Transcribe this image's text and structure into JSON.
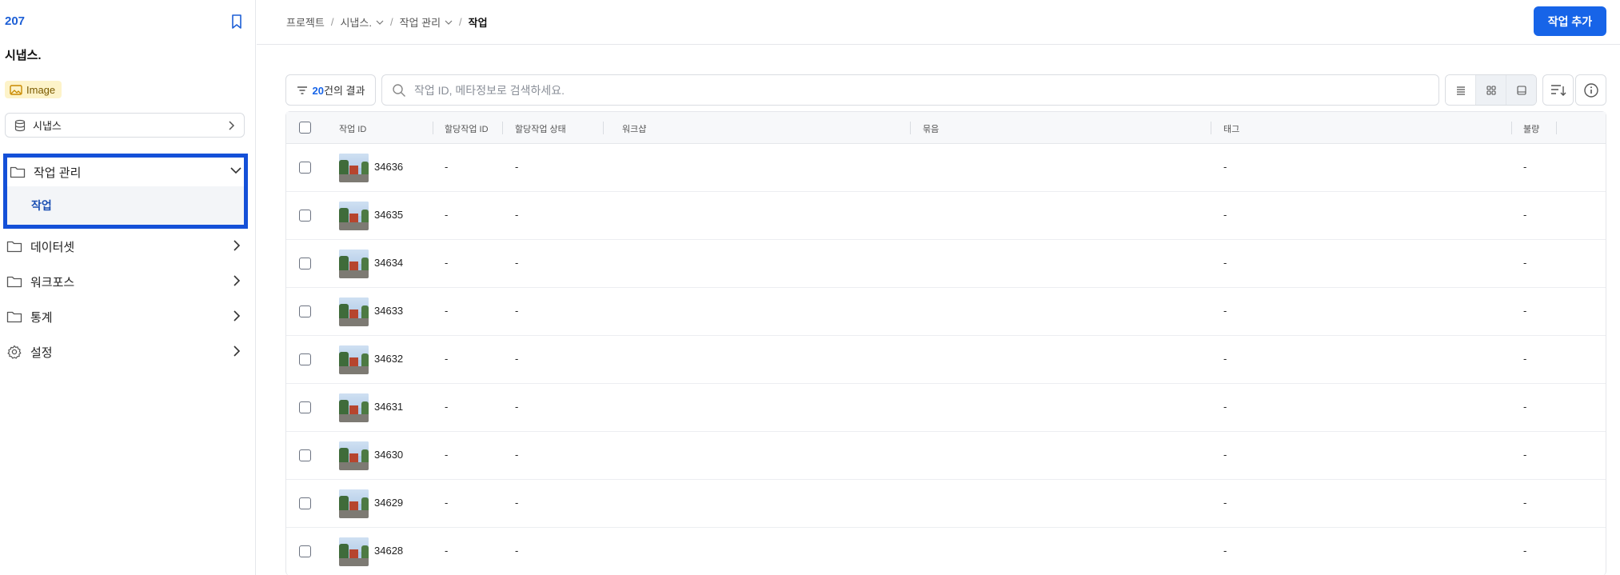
{
  "sidebar": {
    "project_id": "207",
    "project_name": "시냅스.",
    "type_badge": "Image",
    "dataset_label": "시냅스",
    "nav": {
      "task_management": "작업 관리",
      "task": "작업",
      "dataset": "데이터셋",
      "workforce": "워크포스",
      "stats": "통계",
      "settings": "설정"
    }
  },
  "header": {
    "breadcrumb": [
      "프로젝트",
      "시냅스.",
      "작업 관리",
      "작업"
    ],
    "add_button": "작업 추가"
  },
  "toolbar": {
    "result_count": "20",
    "result_suffix": "건의 결과",
    "search_placeholder": "작업 ID, 메타정보로 검색하세요."
  },
  "table": {
    "columns": [
      "작업 ID",
      "할당작업 ID",
      "할당작업 상태",
      "워크샵",
      "묶음",
      "태그",
      "불량"
    ],
    "rows": [
      {
        "id": "34636",
        "assign_id": "-",
        "status": "-",
        "tag": "-",
        "defect": "-"
      },
      {
        "id": "34635",
        "assign_id": "-",
        "status": "-",
        "tag": "-",
        "defect": "-"
      },
      {
        "id": "34634",
        "assign_id": "-",
        "status": "-",
        "tag": "-",
        "defect": "-"
      },
      {
        "id": "34633",
        "assign_id": "-",
        "status": "-",
        "tag": "-",
        "defect": "-"
      },
      {
        "id": "34632",
        "assign_id": "-",
        "status": "-",
        "tag": "-",
        "defect": "-"
      },
      {
        "id": "34631",
        "assign_id": "-",
        "status": "-",
        "tag": "-",
        "defect": "-"
      },
      {
        "id": "34630",
        "assign_id": "-",
        "status": "-",
        "tag": "-",
        "defect": "-"
      },
      {
        "id": "34629",
        "assign_id": "-",
        "status": "-",
        "tag": "-",
        "defect": "-"
      },
      {
        "id": "34628",
        "assign_id": "-",
        "status": "-",
        "tag": "-",
        "defect": "-"
      }
    ]
  },
  "colors": {
    "accent": "#1764e8",
    "highlight_border": "#1450d8",
    "badge_bg": "#fdf3c9"
  }
}
